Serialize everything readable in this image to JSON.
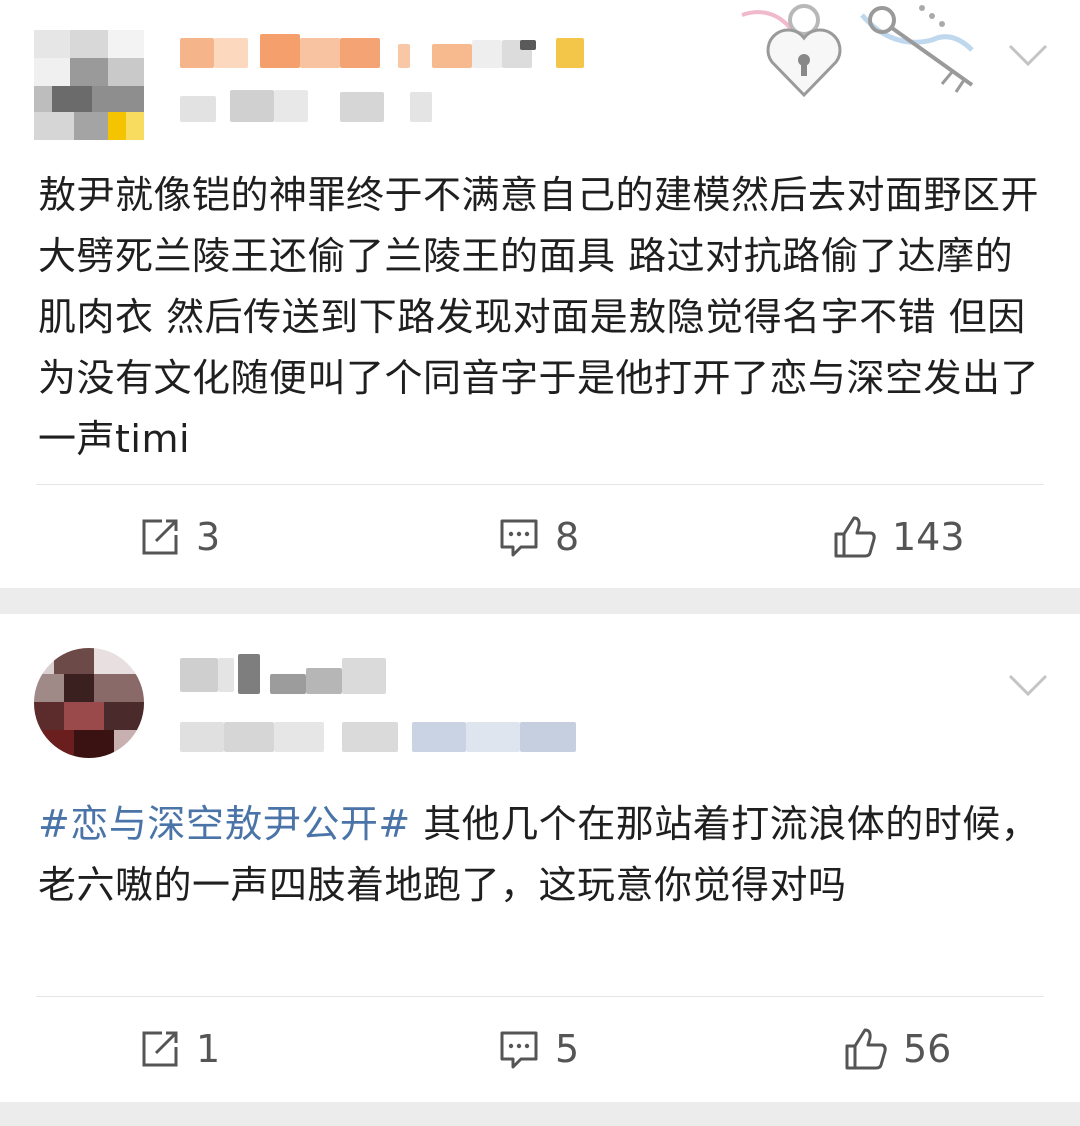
{
  "posts": [
    {
      "text": "敖尹就像铠的神罪终于不满意自己的建模然后去对面野区开大劈死兰陵王还偷了兰陵王的面具 路过对抗路偷了达摩的肌肉衣 然后传送到下路发现对面是敖隐觉得名字不错 但因为没有文化随便叫了个同音字于是他打开了恋与深空发出了一声timi",
      "actions": {
        "share_count": "3",
        "comment_count": "8",
        "like_count": "143"
      }
    },
    {
      "hashtag": "#恋与深空敖尹公开#",
      "text": " 其他几个在那站着打流浪体的时候，老六嗷的一声四肢着地跑了，这玩意你觉得对吗",
      "actions": {
        "share_count": "1",
        "comment_count": "5",
        "like_count": "56"
      }
    }
  ],
  "icons": {
    "share": "share-icon",
    "comment": "comment-icon",
    "like": "thumbs-up-icon",
    "menu": "chevron-down-icon",
    "decor": "heart-lock-key-icon"
  },
  "colors": {
    "hashtag": "#4a74a8",
    "text": "#1f1f1f",
    "icon": "#555555",
    "background": "#f1f1f1"
  }
}
